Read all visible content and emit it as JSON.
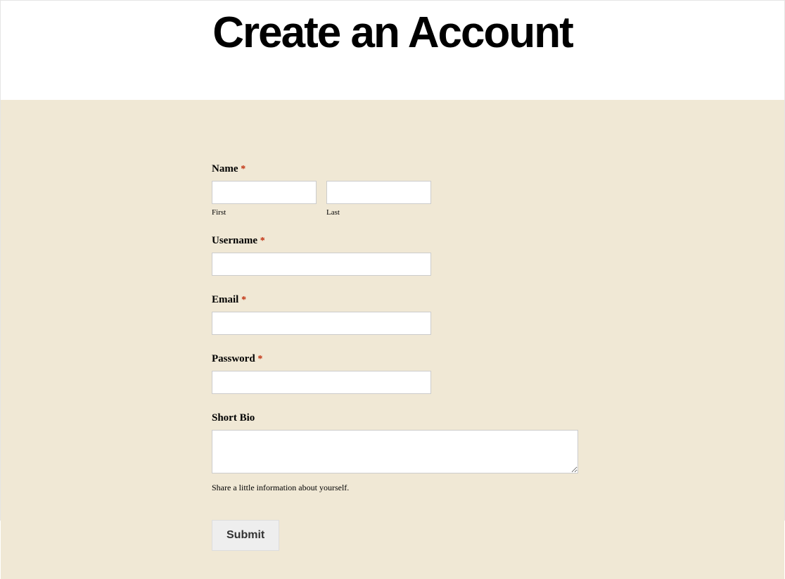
{
  "header": {
    "title": "Create an Account"
  },
  "form": {
    "name": {
      "label": "Name",
      "required_marker": "*",
      "first_sublabel": "First",
      "last_sublabel": "Last",
      "first_value": "",
      "last_value": ""
    },
    "username": {
      "label": "Username",
      "required_marker": "*",
      "value": ""
    },
    "email": {
      "label": "Email",
      "required_marker": "*",
      "value": ""
    },
    "password": {
      "label": "Password",
      "required_marker": "*",
      "value": ""
    },
    "bio": {
      "label": "Short Bio",
      "value": "",
      "description": "Share a little information about yourself."
    },
    "submit_label": "Submit"
  }
}
